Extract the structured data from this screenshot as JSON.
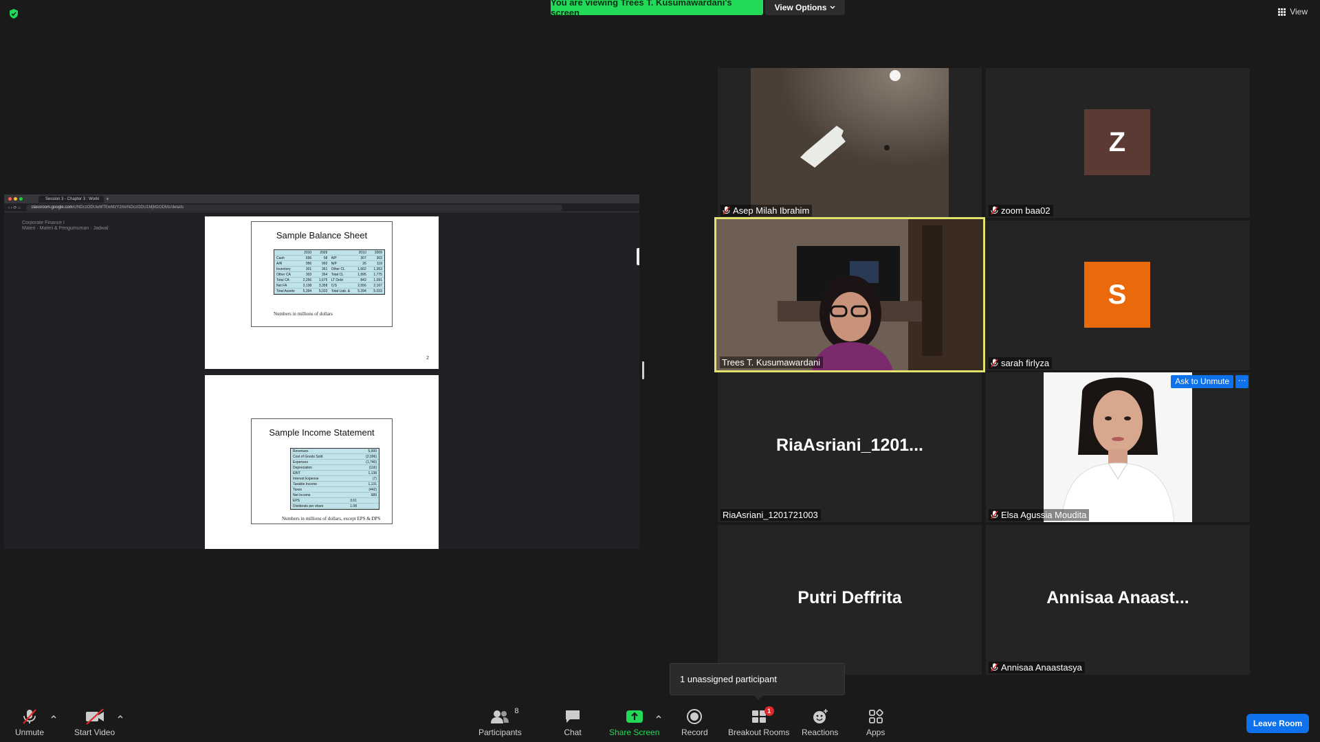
{
  "banner": {
    "sharing_text": "You are viewing Trees T. Kusumawardani's screen",
    "view_options": "View Options",
    "view_label": "View"
  },
  "shared_screen": {
    "tab_title": "Session 3 - Chapter 3 : Worki",
    "url_host": "classroom.google.com",
    "url_path": "/c/NDczODUwMTEwMzY2/m/NDczODU1MjM2ODMz/details",
    "classroom_title": "Corporate Finance I",
    "classroom_sub": "Materi · Materi & Pengumuman · Jadwal",
    "slide1": {
      "title": "Sample Balance Sheet",
      "header": [
        "",
        "2010",
        "2009",
        "",
        "2010",
        "2009"
      ],
      "rows": [
        [
          "Cash",
          "696",
          "58",
          "A/P",
          "307",
          "303"
        ],
        [
          "A/R",
          "956",
          "992",
          "N/P",
          "26",
          "119"
        ],
        [
          "Inventory",
          "301",
          "361",
          "Other CL",
          "1,662",
          "1,353"
        ],
        [
          "Other CA",
          "303",
          "264",
          "Total CL",
          "1,995",
          "1,775"
        ],
        [
          "Total CA",
          "2,256",
          "1,675",
          "LT Debt",
          "843",
          "1,091"
        ],
        [
          "Net FA",
          "3,138",
          "3,358",
          "C/S",
          "2,556",
          "2,167"
        ],
        [
          "Total Assets",
          "5,394",
          "5,033",
          "Total Liab. & Equity",
          "5,394",
          "5,033"
        ]
      ],
      "note": "Numbers in millions of dollars",
      "page": "2"
    },
    "slide2": {
      "title": "Sample Income Statement",
      "rows": [
        [
          "Revenues",
          "",
          "5,000"
        ],
        [
          "Cost of Goods Sold",
          "",
          "(2,006)"
        ],
        [
          "Expenses",
          "",
          "(1,740)"
        ],
        [
          "Depreciation",
          "",
          "(116)"
        ],
        [
          "EBIT",
          "",
          "1,138"
        ],
        [
          "Interest Expense",
          "",
          "(7)"
        ],
        [
          "Taxable Income",
          "",
          "1,131"
        ],
        [
          "Taxes",
          "",
          "(442)"
        ],
        [
          "Net Income",
          "",
          "689"
        ],
        [
          "EPS",
          "3.61",
          ""
        ],
        [
          "Dividends per share",
          "1.08",
          ""
        ]
      ],
      "note": "Numbers in millions of dollars, except EPS & DPS"
    }
  },
  "participants_grid": [
    {
      "name": "Asep Milah Ibrahim",
      "muted": true,
      "kind": "video"
    },
    {
      "name": "zoom baa02",
      "muted": true,
      "kind": "avatar",
      "initial": "Z",
      "color": "#5a3a33"
    },
    {
      "name": "Trees T. Kusumawardani",
      "muted": false,
      "kind": "video-speaker"
    },
    {
      "name": "sarah firlyza",
      "muted": true,
      "kind": "avatar",
      "initial": "S",
      "color": "#ea6a0b"
    },
    {
      "name": "RiaAsriani_1201721003",
      "display": "RiaAsriani_1201...",
      "muted": false,
      "kind": "name"
    },
    {
      "name": "Elsa Agussia Moudita",
      "muted": true,
      "kind": "photo",
      "ask_unmute": "Ask to Unmute",
      "more": "···"
    },
    {
      "name": "Putri Deffrita",
      "display": "Putri Deffrita",
      "muted": false,
      "kind": "name-only"
    },
    {
      "name": "Annisaa Anaastasya",
      "display": "Annisaa  Anaast...",
      "muted": true,
      "kind": "name"
    }
  ],
  "popup": {
    "text": "1 unassigned participant"
  },
  "toolbar": {
    "unmute": "Unmute",
    "start_video": "Start Video",
    "participants": "Participants",
    "participants_count": "8",
    "chat": "Chat",
    "share_screen": "Share Screen",
    "record": "Record",
    "breakout_rooms": "Breakout Rooms",
    "breakout_badge": "1",
    "reactions": "Reactions",
    "apps": "Apps",
    "leave": "Leave Room"
  },
  "colors": {
    "share_green": "#23d959",
    "zoom_blue": "#0e72ed",
    "speaker_outline": "#e2e36f",
    "badge_red": "#e02828"
  }
}
